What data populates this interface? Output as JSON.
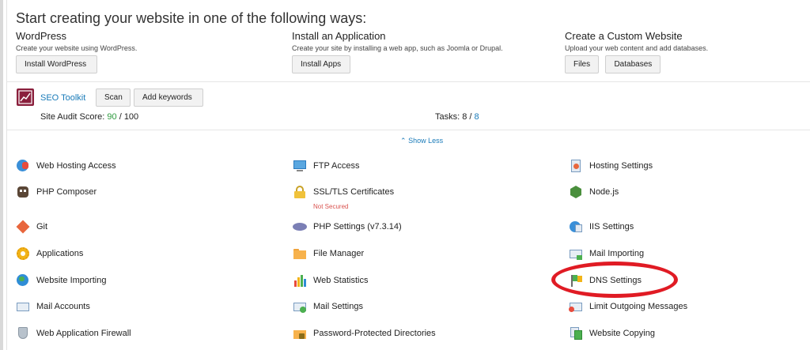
{
  "heading": "Start creating your website in one of the following ways:",
  "options": [
    {
      "title": "WordPress",
      "desc": "Create your website using WordPress.",
      "buttons": [
        "Install WordPress"
      ]
    },
    {
      "title": "Install an Application",
      "desc": "Create your site by installing a web app, such as Joomla or Drupal.",
      "buttons": [
        "Install Apps"
      ]
    },
    {
      "title": "Create a Custom Website",
      "desc": "Upload your web content and add databases.",
      "buttons": [
        "Files",
        "Databases"
      ]
    }
  ],
  "seo": {
    "name": "SEO Toolkit",
    "scan": "Scan",
    "add_keywords": "Add keywords",
    "audit_label": "Site Audit Score:",
    "audit_score": "90",
    "audit_total": "/ 100",
    "tasks_label": "Tasks:",
    "tasks_done": "8 /",
    "tasks_total": "8"
  },
  "show_less": "Show Less",
  "tools": {
    "col1": [
      {
        "label": "Web Hosting Access",
        "icon": "globe-user-icon"
      },
      {
        "label": "PHP Composer",
        "icon": "composer-icon"
      },
      {
        "label": "Git",
        "icon": "git-icon"
      },
      {
        "label": "Applications",
        "icon": "gear-icon"
      },
      {
        "label": "Website Importing",
        "icon": "globe-import-icon"
      },
      {
        "label": "Mail Accounts",
        "icon": "mail-icon"
      },
      {
        "label": "Web Application Firewall",
        "icon": "shield-icon"
      }
    ],
    "col2": [
      {
        "label": "FTP Access",
        "icon": "ftp-icon"
      },
      {
        "label": "SSL/TLS Certificates",
        "icon": "lock-icon",
        "status": "Not Secured"
      },
      {
        "label": "PHP Settings (v7.3.14)",
        "icon": "php-icon"
      },
      {
        "label": "File Manager",
        "icon": "folder-icon"
      },
      {
        "label": "Web Statistics",
        "icon": "bar-chart-icon"
      },
      {
        "label": "Mail Settings",
        "icon": "mail-settings-icon"
      },
      {
        "label": "Password-Protected Directories",
        "icon": "folder-lock-icon"
      }
    ],
    "col3": [
      {
        "label": "Hosting Settings",
        "icon": "hosting-settings-icon"
      },
      {
        "label": "Node.js",
        "icon": "nodejs-icon"
      },
      {
        "label": "IIS Settings",
        "icon": "iis-icon"
      },
      {
        "label": "Mail Importing",
        "icon": "mail-import-icon"
      },
      {
        "label": "DNS Settings",
        "icon": "dns-flag-icon"
      },
      {
        "label": "Limit Outgoing Messages",
        "icon": "limit-mail-icon"
      },
      {
        "label": "Website Copying",
        "icon": "copy-icon"
      }
    ]
  },
  "colors": {
    "link": "#1a7bb9",
    "score": "#2e9b3e",
    "warning": "#d9534f",
    "highlight": "#e01b24"
  }
}
